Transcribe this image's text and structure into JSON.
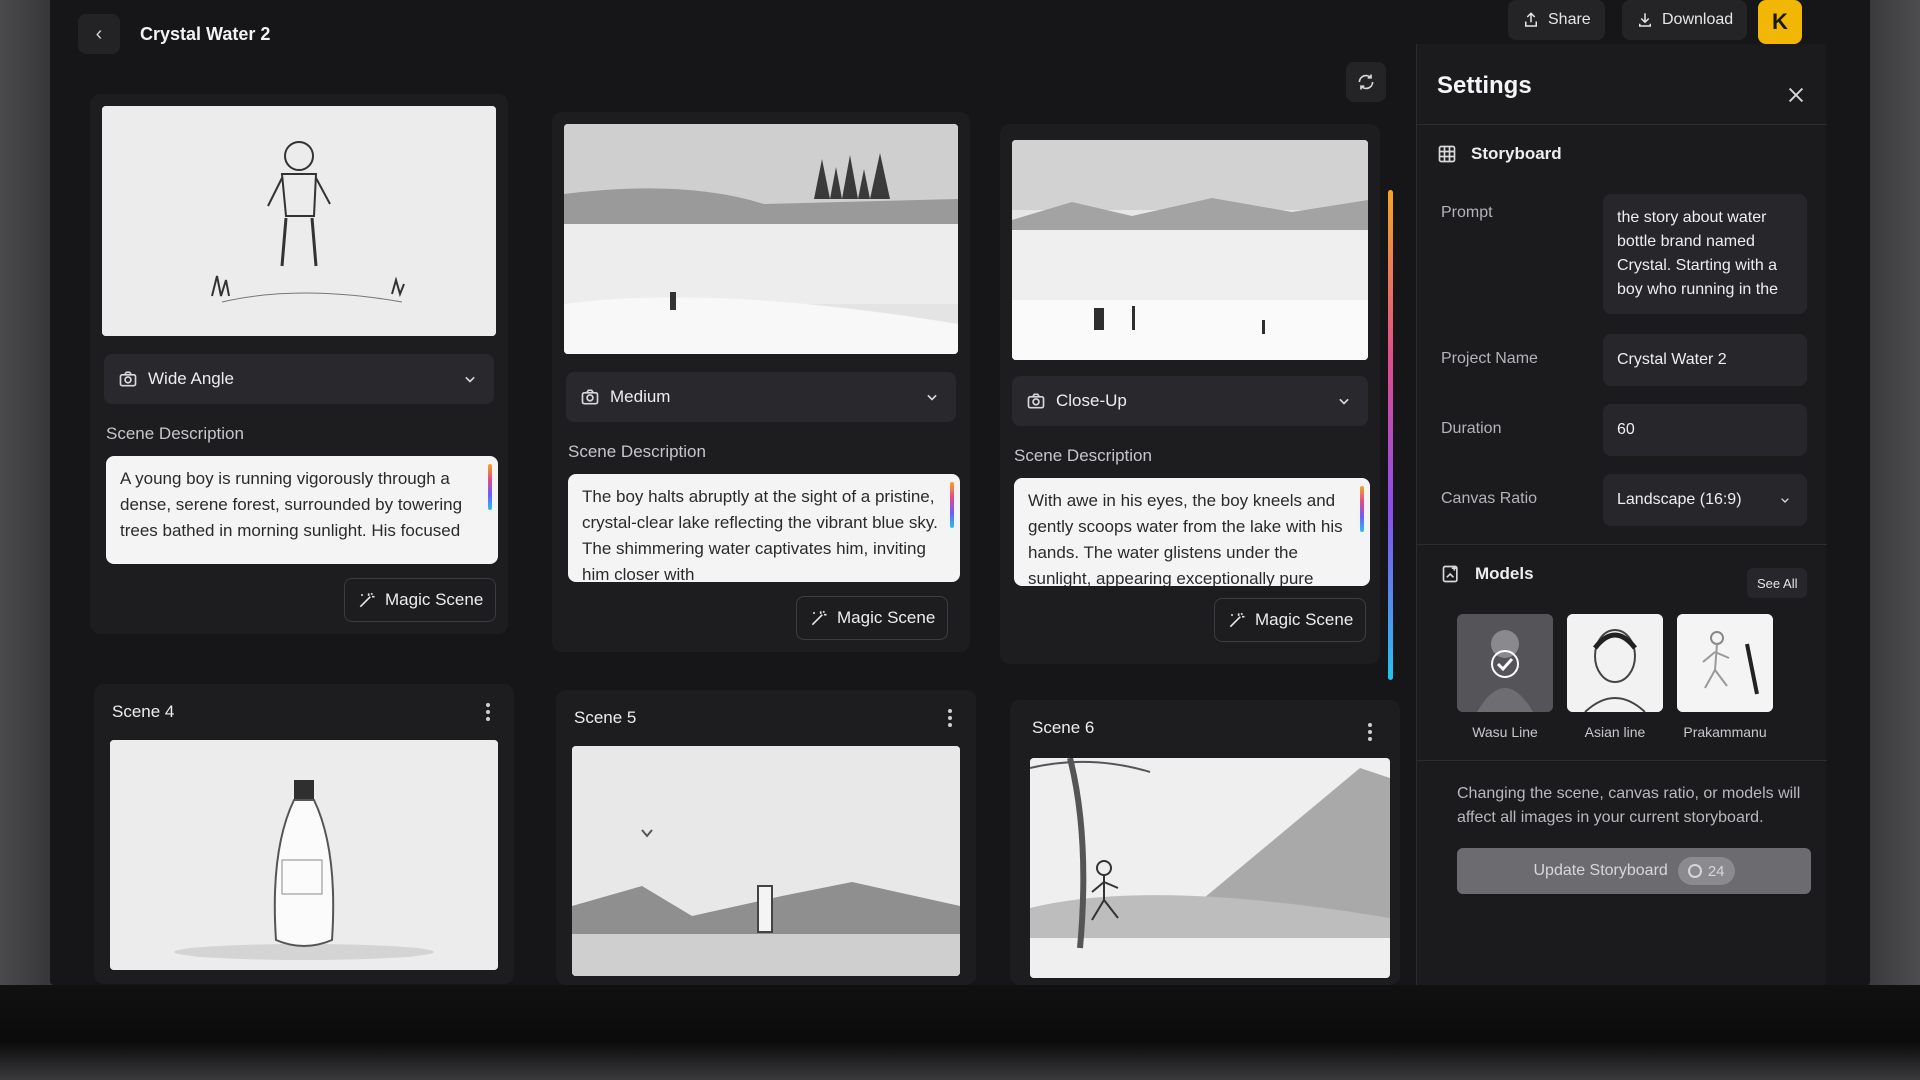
{
  "header": {
    "back_icon": "chevron-left-icon",
    "title": "Crystal Water 2",
    "share_label": "Share",
    "download_label": "Download",
    "avatar_letter": "K"
  },
  "scenes": [
    {
      "shot": "Wide Angle",
      "description_label": "Scene Description",
      "description": "A young boy is running vigorously through a dense, serene forest, surrounded by towering trees bathed in morning sunlight. His focused",
      "magic_label": "Magic Scene"
    },
    {
      "shot": "Medium",
      "description_label": "Scene Description",
      "description": "The boy halts abruptly at the sight of a pristine, crystal-clear lake reflecting the vibrant blue sky. The shimmering water captivates him, inviting him closer with",
      "magic_label": "Magic Scene"
    },
    {
      "shot": "Close-Up",
      "description_label": "Scene Description",
      "description": "With awe in his eyes, the boy kneels and gently scoops water from the lake with his hands. The water glistens under the sunlight, appearing exceptionally pure",
      "magic_label": "Magic Scene"
    },
    {
      "title": "Scene 4"
    },
    {
      "title": "Scene 5"
    },
    {
      "title": "Scene 6"
    }
  ],
  "settings": {
    "title": "Settings",
    "section": "Storyboard",
    "prompt_label": "Prompt",
    "prompt": "the story about water bottle brand named Crystal. Starting with a boy who running in the",
    "project_name_label": "Project Name",
    "project_name": "Crystal Water 2",
    "duration_label": "Duration",
    "duration": "60",
    "ratio_label": "Canvas Ratio",
    "ratio": "Landscape (16:9)",
    "models_label": "Models",
    "see_all": "See All",
    "models": [
      {
        "name": "Wasu Line",
        "selected": true
      },
      {
        "name": "Asian line",
        "selected": false
      },
      {
        "name": "Prakammanu",
        "selected": false
      }
    ],
    "note": "Changing the scene, canvas ratio, or models will affect all images in your current storyboard.",
    "update_label": "Update Storyboard",
    "credits": "24"
  },
  "colors": {
    "accent": "#f2b705",
    "background": "#161618",
    "card": "#1d1d20"
  }
}
